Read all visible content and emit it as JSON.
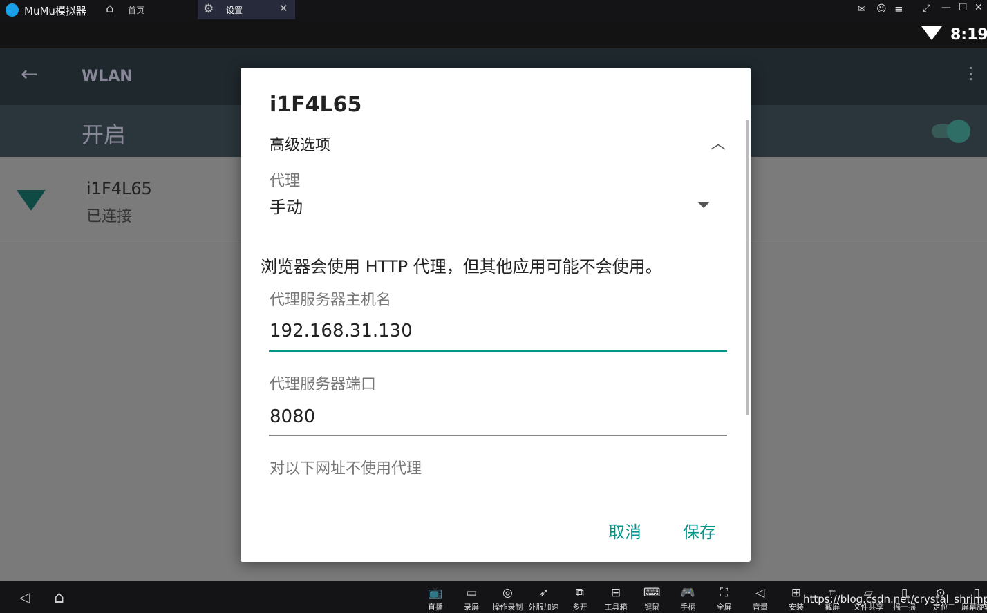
{
  "app": {
    "title": "MuMu模拟器",
    "tabs": [
      {
        "label": "首页"
      },
      {
        "label": "设置"
      }
    ]
  },
  "status": {
    "time": "8:19"
  },
  "settings": {
    "title": "WLAN",
    "switch_label": "开启",
    "switch_on": true,
    "network": {
      "name": "i1F4L65",
      "status": "已连接"
    }
  },
  "dialog": {
    "title": "i1F4L65",
    "advanced": "高级选项",
    "proxy_label": "代理",
    "proxy_value": "手动",
    "note": "浏览器会使用 HTTP 代理，但其他应用可能不会使用。",
    "host_label": "代理服务器主机名",
    "host_value": "192.168.31.130",
    "port_label": "代理服务器端口",
    "port_value": "8080",
    "bypass_label": "对以下网址不使用代理",
    "cancel": "取消",
    "save": "保存"
  },
  "colors": {
    "accent": "#009688"
  },
  "bottom": {
    "tools": [
      {
        "label": "直播",
        "icon": "tv-icon"
      },
      {
        "label": "录屏",
        "icon": "camera-icon"
      },
      {
        "label": "操作录制",
        "icon": "record-icon"
      },
      {
        "label": "外服加速",
        "icon": "rocket-icon"
      },
      {
        "label": "多开",
        "icon": "multi-icon"
      },
      {
        "label": "工具箱",
        "icon": "toolbox-icon"
      },
      {
        "label": "键鼠",
        "icon": "keyboard-icon"
      },
      {
        "label": "手柄",
        "icon": "gamepad-icon"
      },
      {
        "label": "全屏",
        "icon": "fullscreen-icon"
      },
      {
        "label": "音量",
        "icon": "volume-icon"
      },
      {
        "label": "安装",
        "icon": "apk-icon"
      },
      {
        "label": "截屏",
        "icon": "crop-icon"
      },
      {
        "label": "文件共享",
        "icon": "folder-icon"
      },
      {
        "label": "摇一摇",
        "icon": "shake-icon"
      },
      {
        "label": "定位",
        "icon": "location-icon"
      },
      {
        "label": "屏幕旋转",
        "icon": "rotate-icon"
      }
    ],
    "watermark": "https://blog.csdn.net/crystal_shrimps"
  }
}
